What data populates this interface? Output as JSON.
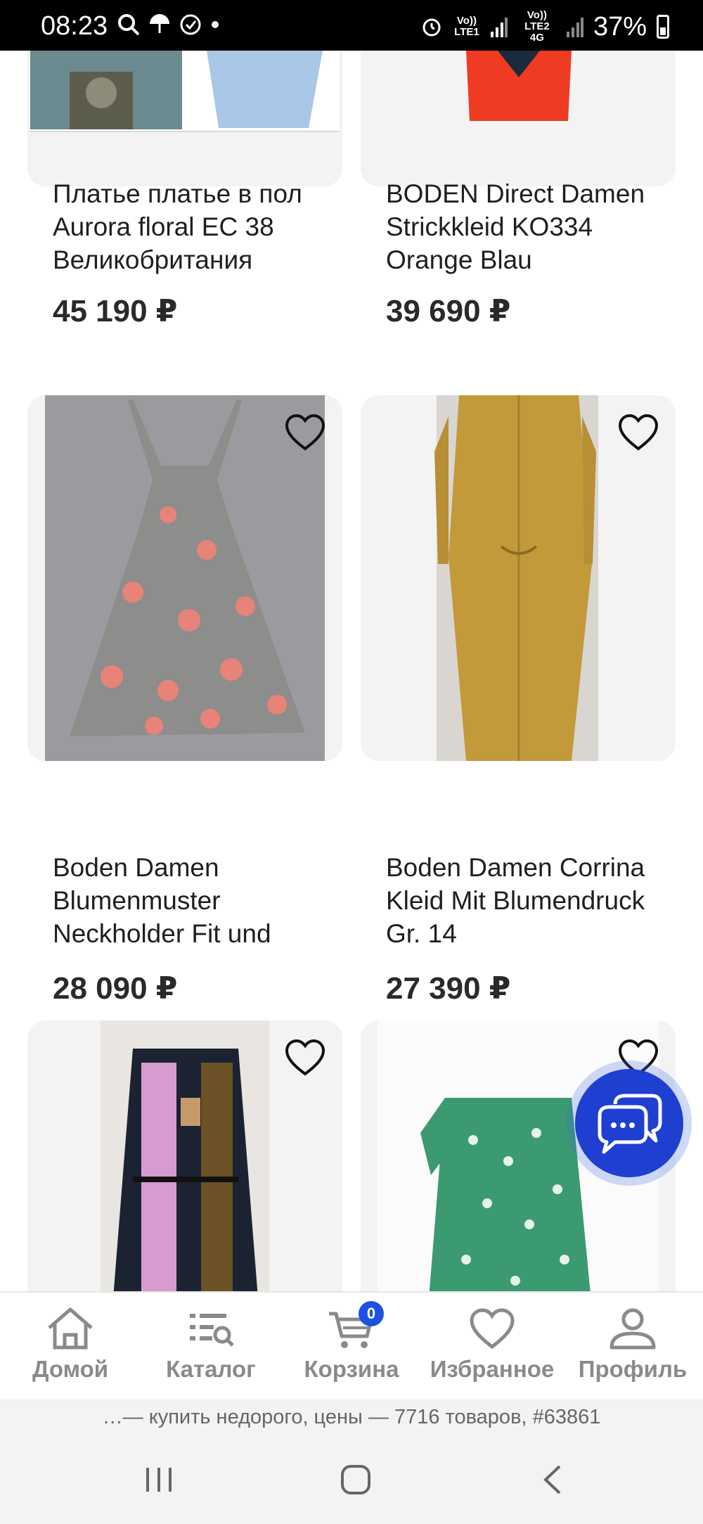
{
  "status_bar": {
    "time": "08:23",
    "net1": "Vo)) LTE1",
    "net2": "Vo)) LTE2 4G",
    "battery": "37%"
  },
  "products": [
    {
      "title": "Платье платье в пол Aurora floral EC 38 Великобритания",
      "price": "45 190 ₽"
    },
    {
      "title": "BODEN Direct Damen Strickkleid KO334 Orange Blau",
      "price": "39 690 ₽"
    },
    {
      "title": "Boden Damen Blumenmuster Neckholder Fit und",
      "price": "28 090 ₽"
    },
    {
      "title": "Boden Damen Corrina Kleid Mit Blumendruck Gr. 14",
      "price": "27 390 ₽"
    }
  ],
  "nav": {
    "home": "Домой",
    "catalog": "Каталог",
    "cart": "Корзина",
    "cart_count": "0",
    "favorites": "Избранное",
    "profile": "Профиль"
  },
  "page_caption": "…— купить недорого, цены — 7716 товаров, #63861",
  "colors": {
    "accent": "#1f3fd1",
    "badge": "#1d52e0",
    "card_bg": "#f3f3f3"
  }
}
